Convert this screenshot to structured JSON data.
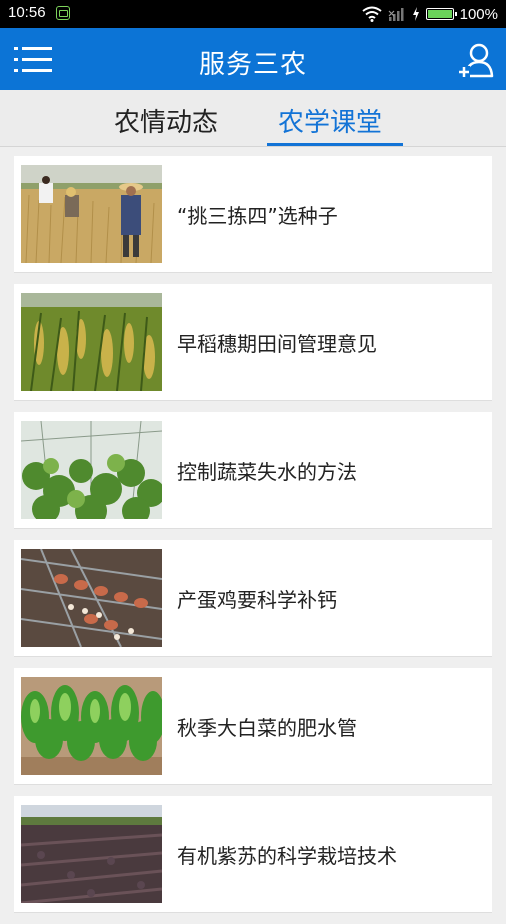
{
  "status_bar": {
    "time": "10:56",
    "battery": "100%"
  },
  "app_bar": {
    "title": "服务三农"
  },
  "tabs": [
    {
      "label": "农情动态",
      "selected": false
    },
    {
      "label": "农学课堂",
      "selected": true
    }
  ],
  "articles": [
    {
      "title": "“挑三拣四”选种子",
      "image": "wheat-field-farmers"
    },
    {
      "title": "早稻穗期田间管理意见",
      "image": "rice-ears"
    },
    {
      "title": "控制蔬菜失水的方法",
      "image": "greenhouse-cucumbers"
    },
    {
      "title": "产蛋鸡要科学补钙",
      "image": "chicken-cages-eggs"
    },
    {
      "title": "秋季大白菜的肥水管",
      "image": "chinese-cabbage"
    },
    {
      "title": "有机紫苏的科学栽培技术",
      "image": "perilla-field"
    }
  ],
  "colors": {
    "accent": "#0c74d6",
    "tab_selected": "#1273d6"
  }
}
